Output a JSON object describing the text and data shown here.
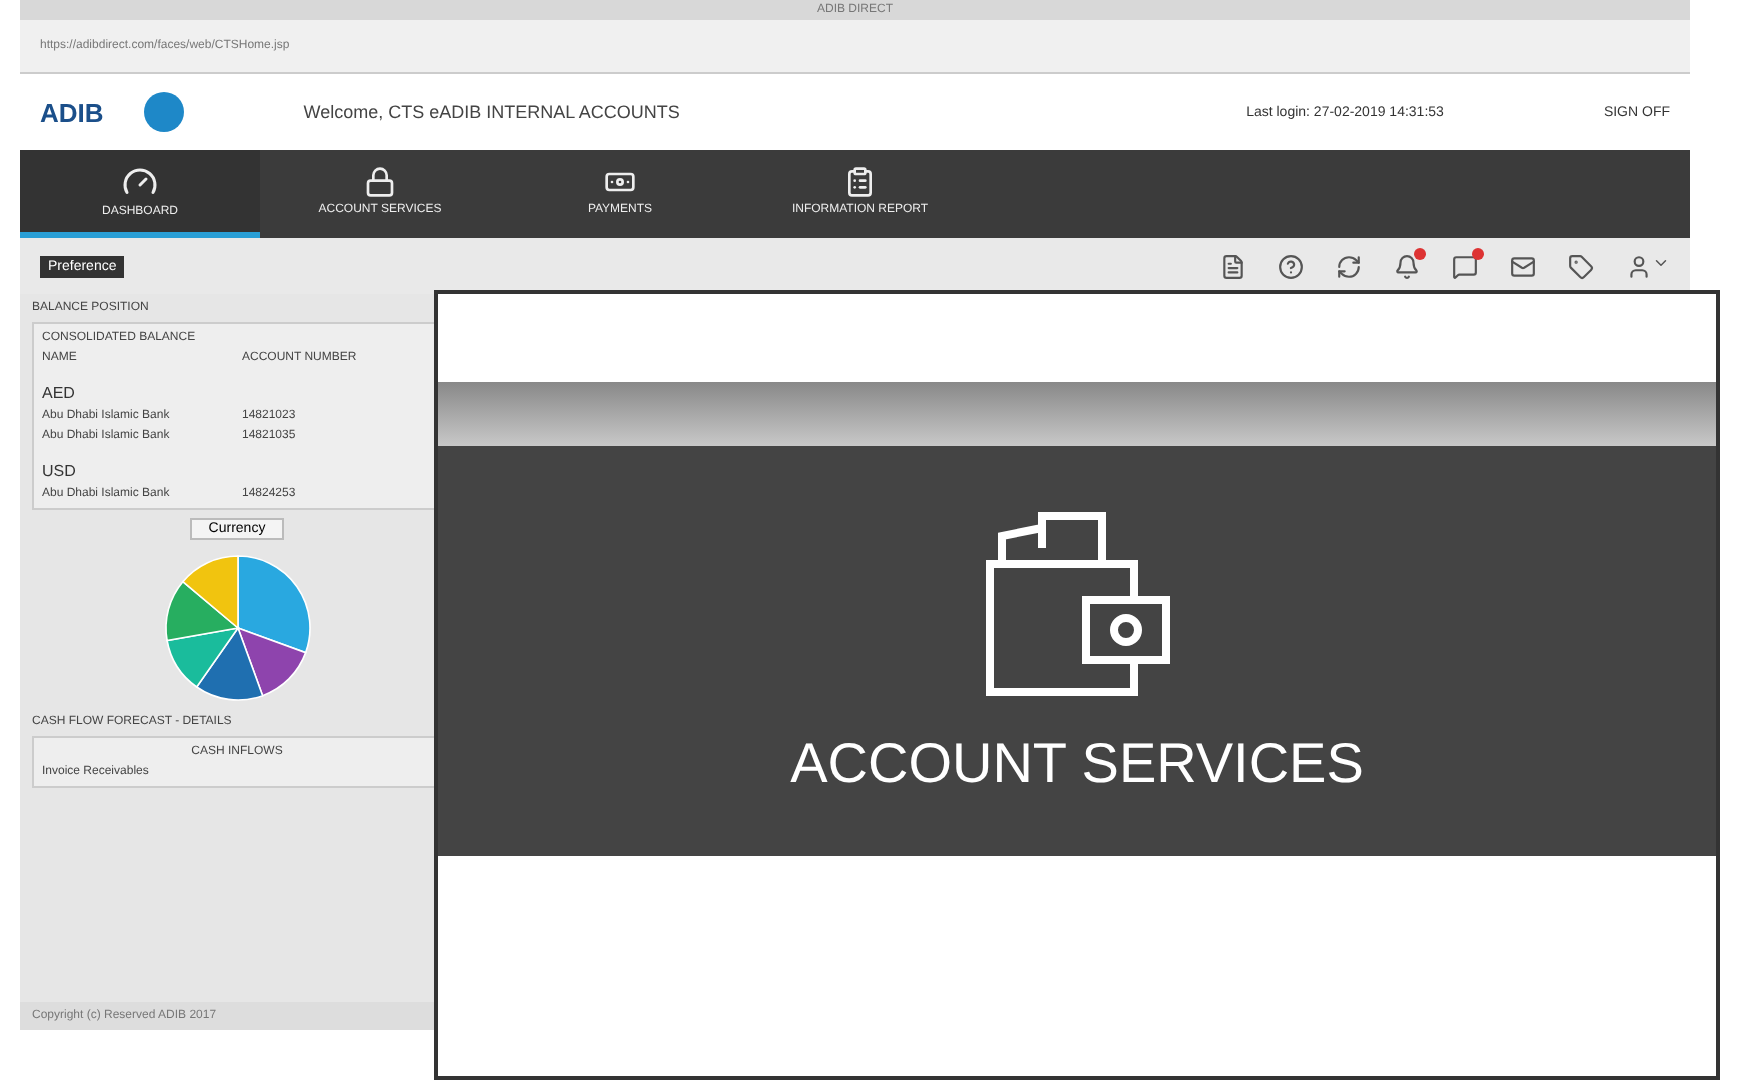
{
  "browser": {
    "title": "ADIB DIRECT",
    "url": "https://adibdirect.com/faces/web/CTSHome.jsp"
  },
  "header": {
    "logo": "ADIB",
    "welcome": "Welcome, CTS eADIB INTERNAL ACCOUNTS",
    "last_login": "Last login: 27-02-2019 14:31:53",
    "sign_off": "SIGN OFF"
  },
  "nav": [
    {
      "label": "DASHBOARD",
      "kind": "gauge",
      "selected": true
    },
    {
      "label": "ACCOUNT SERVICES",
      "kind": "lock",
      "selected": false
    },
    {
      "label": "PAYMENTS",
      "kind": "money",
      "selected": false
    },
    {
      "label": "INFORMATION REPORT",
      "kind": "report",
      "selected": false
    }
  ],
  "preference": "Preference",
  "balance": {
    "title": "BALANCE POSITION",
    "panel_title": "CONSOLIDATED BALANCE",
    "columns": [
      "NAME",
      "ACCOUNT NUMBER"
    ],
    "groups": [
      {
        "currency": "AED",
        "rows": [
          {
            "name": "Abu Dhabi Islamic Bank",
            "account": "14821023"
          },
          {
            "name": "Abu Dhabi Islamic Bank",
            "account": "14821035"
          }
        ]
      },
      {
        "currency": "USD",
        "rows": [
          {
            "name": "Abu Dhabi Islamic Bank",
            "account": "14824253"
          }
        ]
      }
    ]
  },
  "currency_button": "Currency",
  "cash_flow": {
    "title": "CASH FLOW FORECAST - DETAILS",
    "header": "CASH INFLOWS",
    "rows": [
      "Invoice Receivables"
    ]
  },
  "footer": "Copyright (c) Reserved ADIB 2017",
  "callout": {
    "label": "ACCOUNT SERVICES"
  }
}
